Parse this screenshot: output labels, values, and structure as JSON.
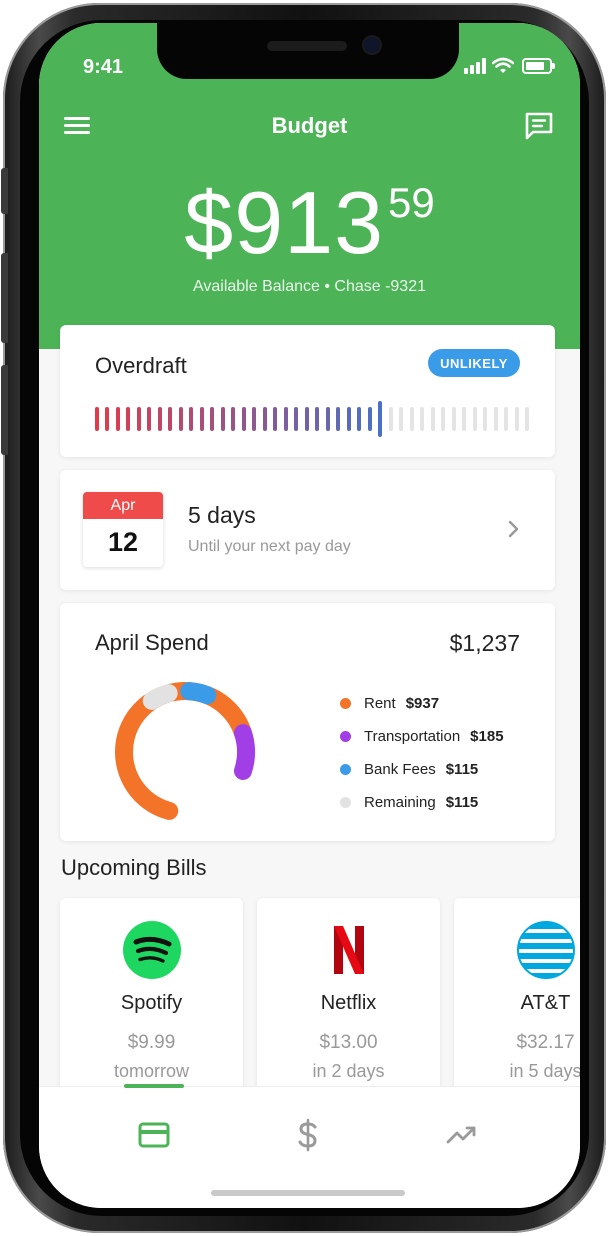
{
  "status": {
    "time": "9:41"
  },
  "header": {
    "title": "Budget",
    "balance_dollars": "$913",
    "balance_cents": "59",
    "balance_label": "Available Balance • Chase -9321"
  },
  "overdraft": {
    "title": "Overdraft",
    "badge": "UNLIKELY",
    "risk_level": 0.67
  },
  "payday": {
    "month": "Apr",
    "day": "12",
    "title": "5 days",
    "subtitle": "Until your next pay day"
  },
  "spend": {
    "title": "April Spend",
    "total": "$1,237",
    "items": [
      {
        "label": "Rent",
        "amount": "$937",
        "value": 937,
        "color": "#f37329"
      },
      {
        "label": "Transportation",
        "amount": "$185",
        "value": 185,
        "color": "#a23ee6"
      },
      {
        "label": "Bank Fees",
        "amount": "$115",
        "value": 115,
        "color": "#3a9be8"
      },
      {
        "label": "Remaining",
        "amount": "$115",
        "value": 115,
        "color": "#e2e2e2"
      }
    ]
  },
  "bills": {
    "title": "Upcoming Bills",
    "items": [
      {
        "name": "Spotify",
        "amount": "$9.99",
        "due": "tomorrow",
        "icon": "spotify-logo"
      },
      {
        "name": "Netflix",
        "amount": "$13.00",
        "due": "in 2 days",
        "icon": "netflix-logo"
      },
      {
        "name": "AT&T",
        "amount": "$32.17",
        "due": "in 5 days",
        "icon": "att-logo"
      }
    ]
  },
  "tabs": [
    {
      "icon": "card-icon",
      "active": true
    },
    {
      "icon": "dollar-icon",
      "active": false
    },
    {
      "icon": "trend-icon",
      "active": false
    }
  ],
  "colors": {
    "brand_green": "#4cb357",
    "badge_blue": "#3a9be8",
    "calendar_red": "#f04b4b"
  }
}
